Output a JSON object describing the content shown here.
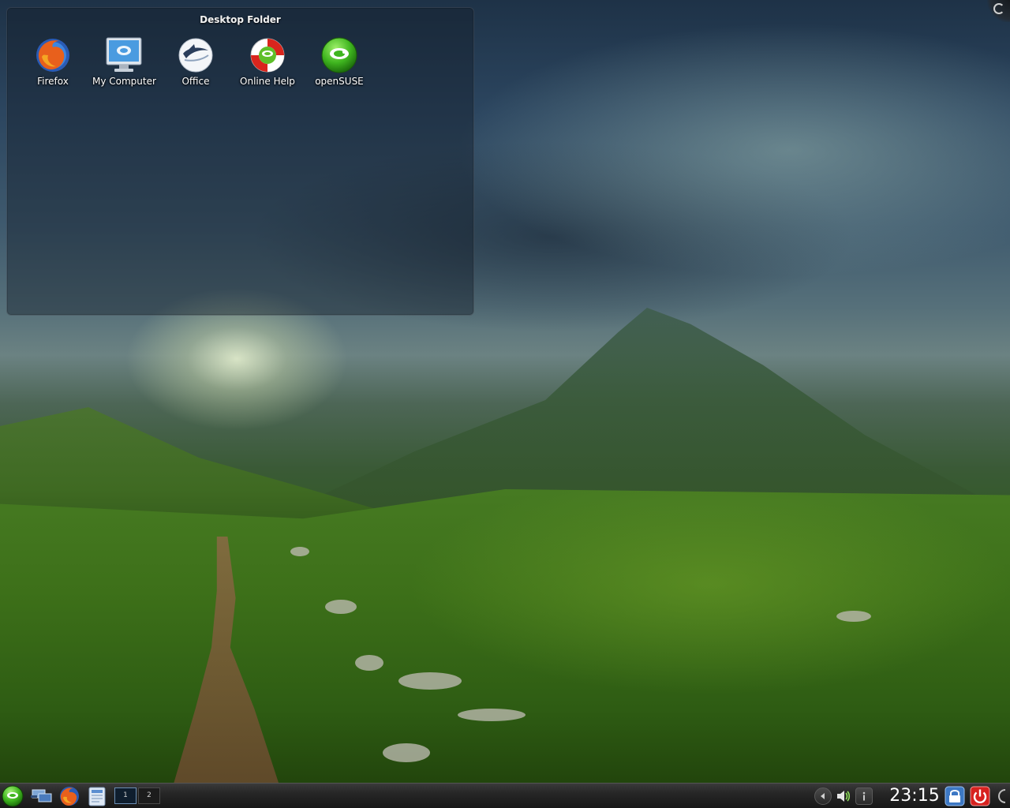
{
  "folder_view": {
    "title": "Desktop Folder",
    "icons": [
      {
        "label": "Firefox",
        "icon": "firefox-icon"
      },
      {
        "label": "My Computer",
        "icon": "computer-monitor-icon"
      },
      {
        "label": "Office",
        "icon": "office-icon"
      },
      {
        "label": "Online Help",
        "icon": "lifebuoy-help-icon"
      },
      {
        "label": "openSUSE",
        "icon": "opensuse-logo-icon"
      }
    ]
  },
  "panel": {
    "launchers": [
      {
        "icon": "kickoff-opensuse-icon"
      },
      {
        "icon": "show-desktop-icon"
      },
      {
        "icon": "firefox-icon"
      },
      {
        "icon": "file-manager-icon"
      }
    ],
    "pager": {
      "desktops": [
        "1",
        "2"
      ],
      "active": "1"
    },
    "tray": [
      {
        "icon": "arrow-left-icon"
      },
      {
        "icon": "volume-icon"
      },
      {
        "icon": "info-icon"
      }
    ],
    "clock": "23:15"
  },
  "colors": {
    "panel": "#262626",
    "opensuse_green": "#4fbf26",
    "logout_red": "#d7221f",
    "lock_blue": "#3d78c4"
  }
}
